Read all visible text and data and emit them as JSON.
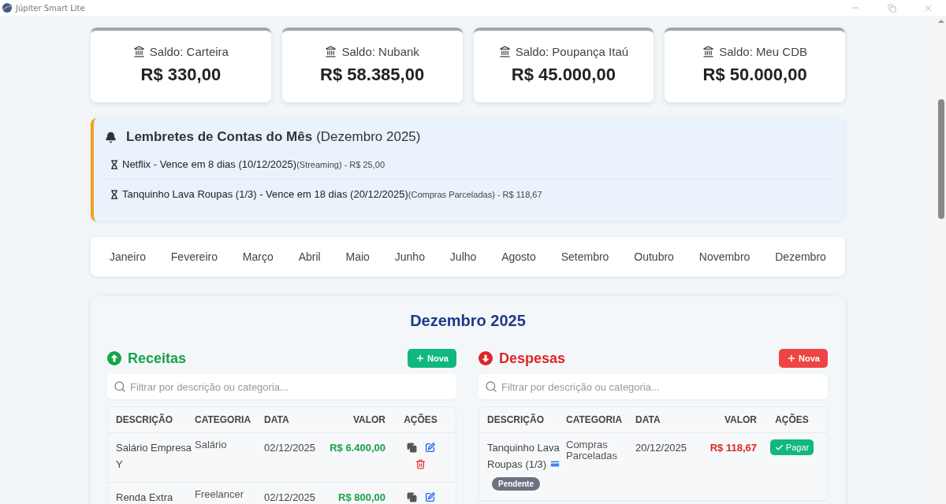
{
  "window": {
    "title": "Júpiter Smart Lite"
  },
  "balances": [
    {
      "label": "Saldo: Carteira",
      "amount": "R$ 330,00"
    },
    {
      "label": "Saldo: Nubank",
      "amount": "R$ 58.385,00"
    },
    {
      "label": "Saldo: Poupança Itaú",
      "amount": "R$ 45.000,00"
    },
    {
      "label": "Saldo: Meu CDB",
      "amount": "R$ 50.000,00"
    }
  ],
  "reminders": {
    "title": "Lembretes de Contas do Mês",
    "period": "(Dezembro 2025)",
    "items": [
      {
        "text": "Netflix - Vence em 8 dias (10/12/2025)",
        "detail": "(Streaming) - R$ 25,00"
      },
      {
        "text": "Tanquinho Lava Roupas (1/3) - Vence em 18 dias (20/12/2025)",
        "detail": "(Compras Parceladas) - R$ 118,67"
      }
    ]
  },
  "months": [
    {
      "label": "Janeiro",
      "selected": false
    },
    {
      "label": "Fevereiro",
      "selected": false
    },
    {
      "label": "Março",
      "selected": false
    },
    {
      "label": "Abril",
      "selected": false
    },
    {
      "label": "Maio",
      "selected": false
    },
    {
      "label": "Junho",
      "selected": false
    },
    {
      "label": "Julho",
      "selected": false
    },
    {
      "label": "Agosto",
      "selected": false
    },
    {
      "label": "Setembro",
      "selected": false
    },
    {
      "label": "Outubro",
      "selected": false
    },
    {
      "label": "Novembro",
      "selected": false
    },
    {
      "label": "Dezembro",
      "selected": false
    }
  ],
  "period_title": "Dezembro 2025",
  "sections": [
    {
      "kind": "income",
      "title": "Receitas",
      "new_button": "Nova",
      "search": {
        "placeholder": "Filtrar por descrição ou categoria..."
      },
      "columns": [
        "DESCRIÇÃO",
        "CATEGORIA",
        "DATA",
        "VALOR",
        "AÇÕES"
      ],
      "rows": [
        {
          "description": "Salário Empresa Y",
          "category": "Salário",
          "date": "02/12/2025",
          "value": "R$ 6.400,00"
        },
        {
          "description": "Renda Extra",
          "category": "Freelancer",
          "date": "02/12/2025",
          "value": "R$ 800,00"
        }
      ]
    },
    {
      "kind": "expense",
      "title": "Despesas",
      "new_button": "Nova",
      "search": {
        "placeholder": "Filtrar por descrição ou categoria..."
      },
      "columns": [
        "DESCRIÇÃO",
        "CATEGORIA",
        "DATA",
        "VALOR",
        "AÇÕES"
      ],
      "rows": [
        {
          "description": "Tanquinho Lava Roupas (1/3)",
          "card": true,
          "category": "Compras Parceladas",
          "date": "20/12/2025",
          "value": "R$ 118,67",
          "status": "Pendente",
          "action": "Pagar"
        }
      ]
    }
  ]
}
